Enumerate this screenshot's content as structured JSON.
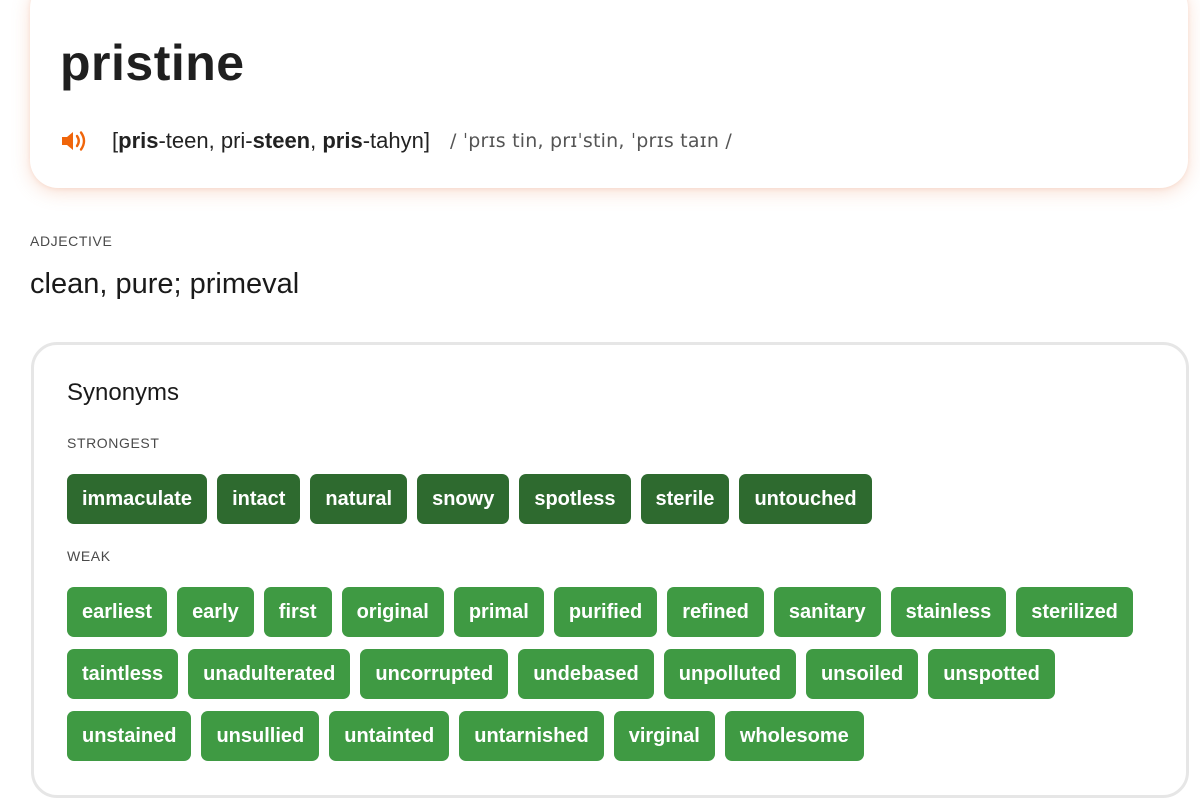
{
  "headword": "pristine",
  "pronunciation": {
    "spell_parts": [
      {
        "text": "[",
        "bold": false
      },
      {
        "text": "pris",
        "bold": true
      },
      {
        "text": "-teen, pri-",
        "bold": false
      },
      {
        "text": "steen",
        "bold": true
      },
      {
        "text": ", ",
        "bold": false
      },
      {
        "text": "pris",
        "bold": true
      },
      {
        "text": "-tahyn]",
        "bold": false
      }
    ],
    "ipa": "/ ˈprɪs tin, prɪˈstin, ˈprɪs taɪn /",
    "speaker_icon": "speaker-icon",
    "accent_color": "#f0650a"
  },
  "entry": {
    "part_of_speech": "ADJECTIVE",
    "definition": "clean, pure; primeval"
  },
  "synonyms": {
    "title": "Synonyms",
    "strongest_label": "STRONGEST",
    "weak_label": "WEAK",
    "strongest": [
      "immaculate",
      "intact",
      "natural",
      "snowy",
      "spotless",
      "sterile",
      "untouched"
    ],
    "weak": [
      "earliest",
      "early",
      "first",
      "original",
      "primal",
      "purified",
      "refined",
      "sanitary",
      "stainless",
      "sterilized",
      "taintless",
      "unadulterated",
      "uncorrupted",
      "undebased",
      "unpolluted",
      "unsoiled",
      "unspotted",
      "unstained",
      "unsullied",
      "untainted",
      "untarnished",
      "virginal",
      "wholesome"
    ],
    "strong_color": "#2e6a2f",
    "weak_color": "#3f9a43"
  }
}
